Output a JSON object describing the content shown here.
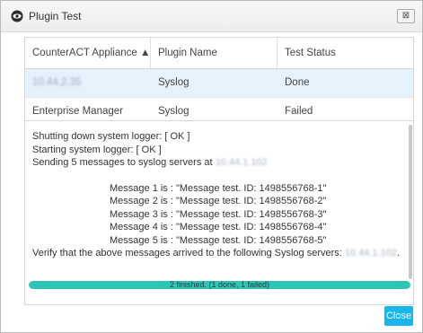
{
  "window": {
    "title": "Plugin Test",
    "close_glyph": "⊠",
    "title_icon": "eye-icon",
    "close_icon": "close-icon"
  },
  "table": {
    "columns": [
      "CounterACT Appliance ▲",
      "Plugin Name",
      "Test Status"
    ],
    "rows": [
      {
        "appliance": "10.44.2.35",
        "plugin": "Syslog",
        "status": "Done",
        "selected": true
      },
      {
        "appliance": "Enterprise Manager",
        "plugin": "Syslog",
        "status": "Failed",
        "selected": false
      }
    ]
  },
  "output": {
    "line1": "Shutting down system logger: [ OK ]",
    "line2": "Starting system logger: [ OK ]",
    "line3_prefix": "Sending 5 messages to syslog servers at ",
    "line3_ip": "10.44.1.102",
    "messages": [
      "Message 1 is : \"Message test. ID: 1498556768-1\"",
      "Message 2 is : \"Message test. ID: 1498556768-2\"",
      "Message 3 is : \"Message test. ID: 1498556768-3\"",
      "Message 4 is : \"Message test. ID: 1498556768-4\"",
      "Message 5 is : \"Message test. ID: 1498556768-5\""
    ],
    "verify_prefix": "Verify that the above messages arrived to the following Syslog servers: ",
    "verify_ip": "10.44.1.102",
    "verify_suffix": "."
  },
  "progress": {
    "text": "2 finished. (1 done, 1 failed)",
    "fraction": 1.0,
    "color": "#2dc5b8"
  },
  "close_button": {
    "label": "Close",
    "color": "#1ab5eb"
  }
}
